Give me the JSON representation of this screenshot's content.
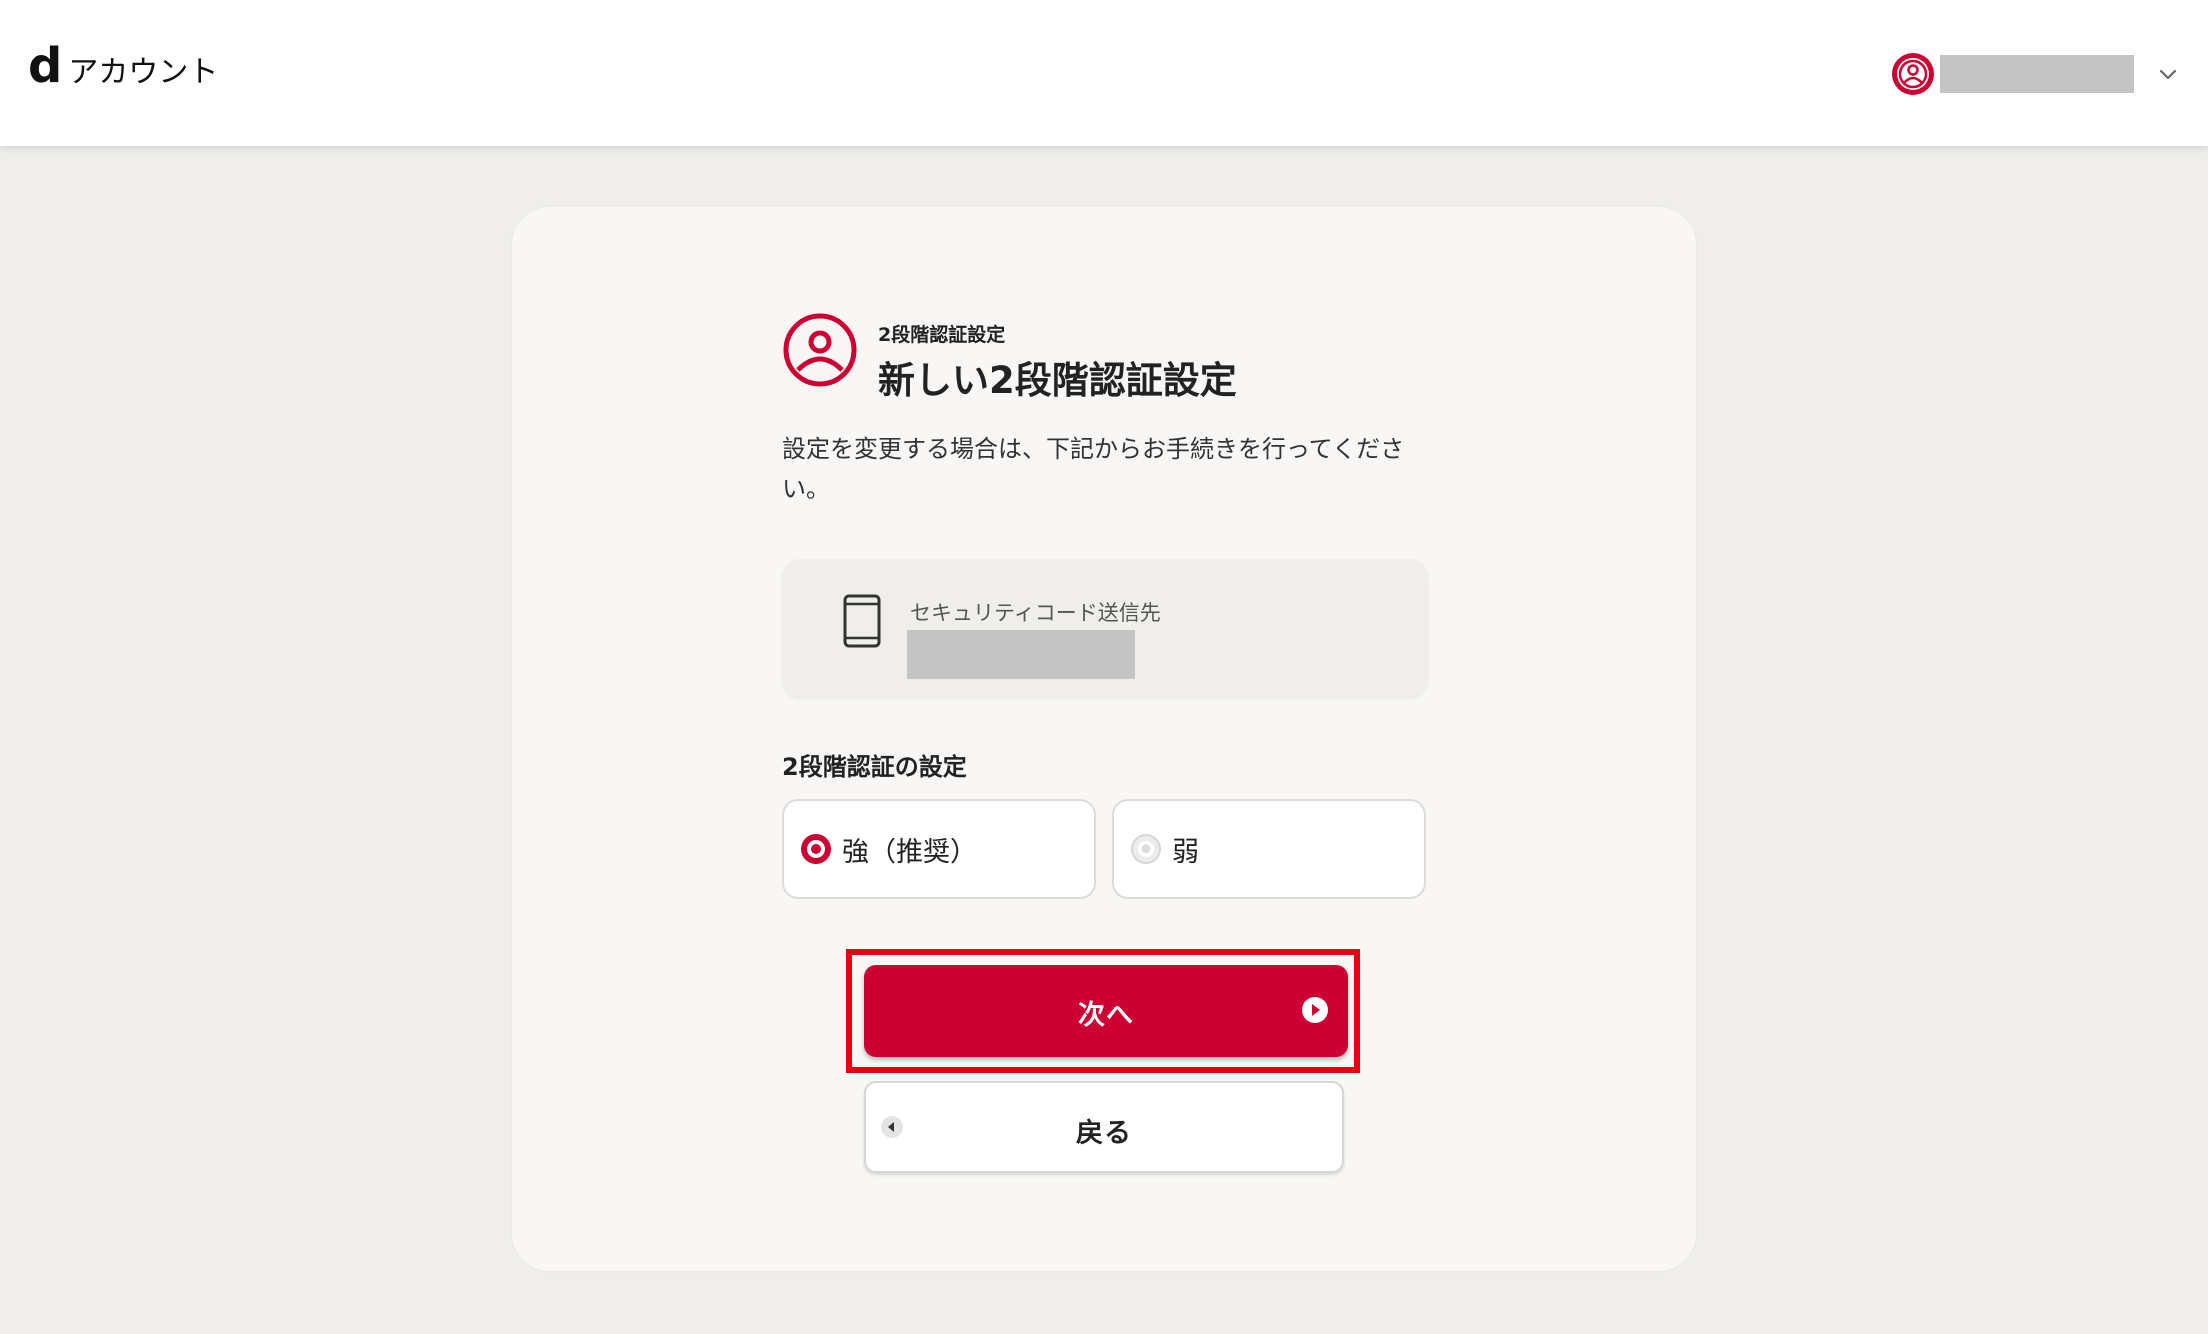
{
  "header": {
    "logo_mark": "d",
    "logo_text": "アカウント",
    "user_name_masked": ""
  },
  "card": {
    "title_small": "2段階認証設定",
    "title_main": "新しい2段階認証設定",
    "description": "設定を変更する場合は、下記からお手続きを行ってください。",
    "destination": {
      "label": "セキュリティコード送信先",
      "value_masked": ""
    },
    "setting_label": "2段階認証の設定",
    "options": [
      {
        "label": "強（推奨）",
        "selected": true
      },
      {
        "label": "弱",
        "selected": false
      }
    ],
    "next_button": "次へ",
    "back_button": "戻る"
  },
  "colors": {
    "accent": "#cc0033",
    "highlight": "#e60012",
    "background": "#efeeec"
  },
  "icons": [
    "account-icon",
    "chevron-down-icon",
    "user-circle-icon",
    "smartphone-icon",
    "radio-selected-icon",
    "radio-unselected-icon",
    "arrow-right-circle-icon",
    "arrow-left-circle-icon"
  ]
}
